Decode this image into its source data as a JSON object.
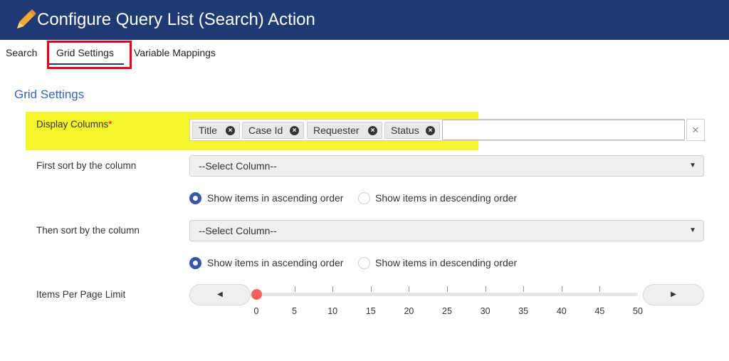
{
  "header": {
    "title": "Configure Query List (Search) Action",
    "icon": "pencil-icon",
    "background": "#1d3a73"
  },
  "tabs": [
    {
      "label": "Search"
    },
    {
      "label": "Grid Settings",
      "active": true
    },
    {
      "label": "Variable Mappings"
    }
  ],
  "section": {
    "title": "Grid Settings"
  },
  "display_columns": {
    "label": "Display Columns",
    "required_mark": "*",
    "tags": [
      "Title",
      "Case Id",
      "Requester",
      "Status"
    ],
    "input_value": "",
    "clear_symbol": "×"
  },
  "first_sort": {
    "label": "First sort by the column",
    "selected": "--Select Column--",
    "ascending_label": "Show items in ascending order",
    "descending_label": "Show items in descending order",
    "selected_order": "ascending"
  },
  "then_sort": {
    "label": "Then sort by the column",
    "selected": "--Select Column--",
    "ascending_label": "Show items in ascending order",
    "descending_label": "Show items in descending order",
    "selected_order": "ascending"
  },
  "items_per_page": {
    "label": "Items Per Page Limit",
    "value": 0,
    "min": 0,
    "max": 50,
    "ticks": [
      "0",
      "5",
      "10",
      "15",
      "20",
      "25",
      "30",
      "35",
      "40",
      "45",
      "50"
    ],
    "prev_symbol": "◀",
    "next_symbol": "▶"
  },
  "colors": {
    "accent": "#3569b5",
    "highlight": "#f4f529",
    "annotation": "#e3001b",
    "slider_handle": "#f25f5c"
  }
}
